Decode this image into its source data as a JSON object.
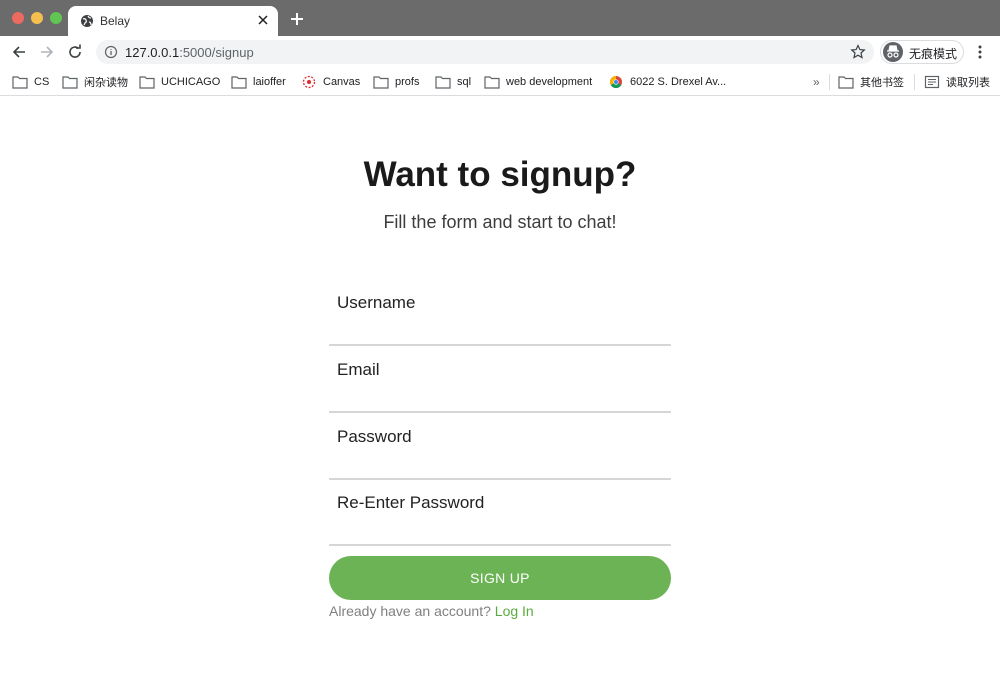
{
  "browser": {
    "tab": {
      "title": "Belay",
      "icon": "globe-icon"
    },
    "url": {
      "host": "127.0.0.1",
      "path": ":5000/signup"
    },
    "incognito_label": "无痕模式",
    "bookmarks": [
      {
        "label": "CS",
        "icon": "folder-icon"
      },
      {
        "label": "闲杂读物",
        "icon": "folder-icon"
      },
      {
        "label": "UCHICAGO",
        "icon": "folder-icon"
      },
      {
        "label": "laioffer",
        "icon": "folder-icon"
      },
      {
        "label": "Canvas",
        "icon": "canvas-icon"
      },
      {
        "label": "profs",
        "icon": "folder-icon"
      },
      {
        "label": "sql",
        "icon": "folder-icon"
      },
      {
        "label": "web development",
        "icon": "folder-icon"
      },
      {
        "label": "6022 S. Drexel Av...",
        "icon": "chrome-icon"
      }
    ],
    "overflow_chevron": "»",
    "other_bookmarks": "其他书签",
    "reading_list": "读取列表"
  },
  "page": {
    "title": "Want to signup?",
    "subtitle": "Fill the form and start to chat!",
    "fields": {
      "username_placeholder": "Username",
      "email_placeholder": "Email",
      "password_placeholder": "Password",
      "reenter_placeholder": "Re-Enter Password"
    },
    "signup_button": "SIGN UP",
    "login_prompt": "Already have an account?",
    "login_link": "Log In",
    "accent_color": "#6cb356"
  }
}
